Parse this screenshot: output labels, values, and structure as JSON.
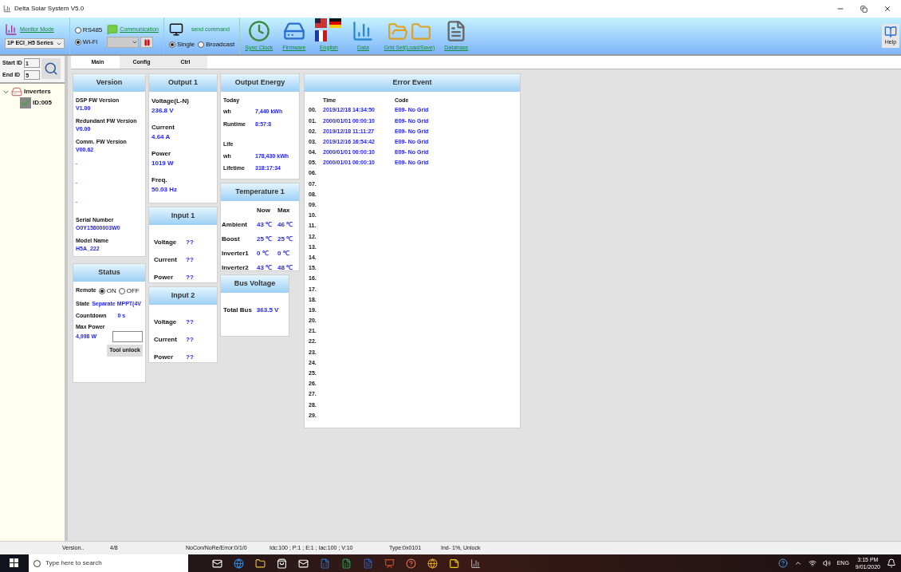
{
  "window": {
    "title": "Delta Solar System V5.0"
  },
  "toolbar": {
    "monitor_label": "Monitor Mode",
    "series": "1P ECI_H5 Series",
    "connections": [
      {
        "label": "RS485",
        "selected": false
      },
      {
        "label": "Wi-Fi",
        "selected": true
      }
    ],
    "communication": "Communication",
    "send_command": "send command",
    "send_modes": [
      {
        "label": "Single",
        "selected": true
      },
      {
        "label": "Broadcast",
        "selected": false
      }
    ],
    "buttons": [
      {
        "kind": "clock",
        "label": "Sync Clock"
      },
      {
        "kind": "firmware",
        "label": "Firmware"
      },
      {
        "kind": "language",
        "label": "English"
      },
      {
        "kind": "data",
        "label": "Data"
      },
      {
        "kind": "grid",
        "label": "Grid Set(Load/Save)"
      },
      {
        "kind": "database",
        "label": "Database"
      }
    ],
    "help": "Help"
  },
  "sidebar": {
    "start_label": "Start ID",
    "start_value": "1",
    "end_label": "End ID",
    "end_value": "5",
    "tree": [
      {
        "label": "Inverters",
        "expanded": true,
        "children": [
          {
            "label": "ID:005"
          }
        ]
      }
    ]
  },
  "tabs": [
    {
      "label": "Main",
      "selected": true
    },
    {
      "label": "Config",
      "selected": false
    },
    {
      "label": "Ctrl",
      "selected": false
    }
  ],
  "version": {
    "title": "Version",
    "items": [
      {
        "label": "DSP FW Version",
        "value": "V1.00"
      },
      {
        "label": "Redundant FW Version",
        "value": "V0.00"
      },
      {
        "label": "Comm. FW Version",
        "value": "V00.62"
      },
      {
        "value": "."
      },
      {
        "value": "."
      },
      {
        "value": "."
      },
      {
        "label": "Serial Number",
        "value": "O0Y15800003W0"
      },
      {
        "label": "Model Name",
        "value": "H5A_222"
      }
    ]
  },
  "status": {
    "title": "Status",
    "remote_label": "Remote",
    "remote_options": [
      {
        "label": "ON",
        "selected": true
      },
      {
        "label": "OFF",
        "selected": false
      }
    ],
    "state_label": "State",
    "state_value": "Separate MPPT(4V",
    "countdown_label": "Countdown",
    "countdown_value": "0 s",
    "max_power_label": "Max Power",
    "max_power_value": "4,998 W",
    "unlock_button": "Tool unlock"
  },
  "output1": {
    "title": "Output 1",
    "items": [
      {
        "label": "Voltage(L-N)",
        "value": "236.8 V"
      },
      {
        "label": "Current",
        "value": "4.64 A"
      },
      {
        "label": "Power",
        "value": "1019 W"
      },
      {
        "label": "Freq.",
        "value": "50.03 Hz"
      }
    ]
  },
  "input1": {
    "title": "Input 1",
    "items": [
      {
        "label": "Voltage",
        "value": "??"
      },
      {
        "label": "Current",
        "value": "??"
      },
      {
        "label": "Power",
        "value": "??"
      }
    ]
  },
  "input2": {
    "title": "Input 2",
    "items": [
      {
        "label": "Voltage",
        "value": "??"
      },
      {
        "label": "Current",
        "value": "??"
      },
      {
        "label": "Power",
        "value": "??"
      }
    ]
  },
  "output_energy": {
    "title": "Output Energy",
    "groups": [
      {
        "heading": "Today",
        "rows": [
          {
            "label": "wh",
            "value": "7,440 kWh"
          },
          {
            "label": "Runtime",
            "value": "8:57:8"
          }
        ]
      },
      {
        "heading": "Life",
        "rows": [
          {
            "label": "wh",
            "value": "178,430 kWh"
          },
          {
            "label": "Lifetime",
            "value": "318:17:34"
          }
        ]
      }
    ]
  },
  "temperature": {
    "title": "Temperature 1",
    "columns": [
      "Now",
      "Max"
    ],
    "rows": [
      {
        "label": "Ambient",
        "now": "43 ℃",
        "max": "46 ℃"
      },
      {
        "label": "Boost",
        "now": "25 ℃",
        "max": "25 ℃"
      },
      {
        "label": "Inverter1",
        "now": "0 ℃",
        "max": "0 ℃"
      },
      {
        "label": "Inverter2",
        "now": "43 ℃",
        "max": "48 ℃"
      }
    ]
  },
  "bus_voltage": {
    "title": "Bus Voltage",
    "label": "Total Bus",
    "value": "363.5 V"
  },
  "error_event": {
    "title": "Error Event",
    "columns": [
      "Time",
      "Code"
    ],
    "rows": [
      {
        "index": "00.",
        "time": "2019/12/18 14:34:50",
        "code": "E09- No Grid"
      },
      {
        "index": "01.",
        "time": "2000/01/01 00:00:10",
        "code": "E09- No Grid"
      },
      {
        "index": "02.",
        "time": "2019/12/18 11:11:27",
        "code": "E09- No Grid"
      },
      {
        "index": "03.",
        "time": "2019/12/16 16:54:42",
        "code": "E09- No Grid"
      },
      {
        "index": "04.",
        "time": "2000/01/01 00:00:10",
        "code": "E09- No Grid"
      },
      {
        "index": "05.",
        "time": "2000/01/01 00:00:10",
        "code": "E09- No Grid"
      },
      {
        "index": "06."
      },
      {
        "index": "07."
      },
      {
        "index": "08."
      },
      {
        "index": "09."
      },
      {
        "index": "10."
      },
      {
        "index": "11."
      },
      {
        "index": "12."
      },
      {
        "index": "13."
      },
      {
        "index": "14."
      },
      {
        "index": "15."
      },
      {
        "index": "16."
      },
      {
        "index": "17."
      },
      {
        "index": "18."
      },
      {
        "index": "19."
      },
      {
        "index": "20."
      },
      {
        "index": "21."
      },
      {
        "index": "22."
      },
      {
        "index": "23."
      },
      {
        "index": "24."
      },
      {
        "index": "25."
      },
      {
        "index": "26."
      },
      {
        "index": "27."
      },
      {
        "index": "28."
      },
      {
        "index": "29."
      }
    ]
  },
  "status_bar": [
    "Version..",
    "4/8",
    "NoCon/NoRe/Error:0/1/0",
    "Idc:100 ; P:1 ; E:1 ; Iac:100 ; V:10",
    "Type:0x0101",
    "Ind- 1%, Unlock"
  ],
  "taskbar": {
    "search_placeholder": "Type here to search",
    "language": "ENG",
    "time": "3:15 PM",
    "date": "9/01/2020"
  }
}
